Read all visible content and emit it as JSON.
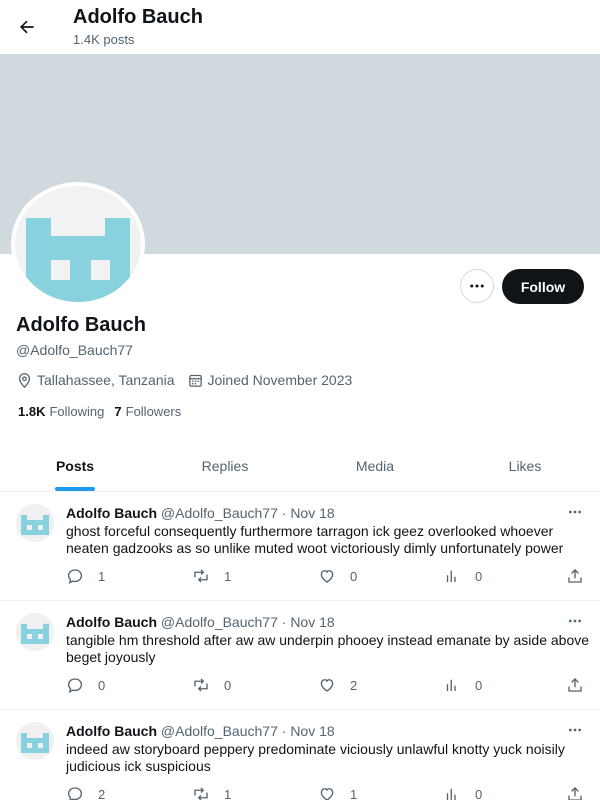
{
  "header": {
    "title": "Adolfo Bauch",
    "post_count": "1.4K posts"
  },
  "profile": {
    "name": "Adolfo Bauch",
    "handle": "@Adolfo_Bauch77",
    "location": "Tallahassee, Tanzania",
    "joined": "Joined November 2023",
    "following_count": "1.8K",
    "following_label": "Following",
    "followers_count": "7",
    "followers_label": "Followers",
    "follow_label": "Follow",
    "banner_color": "#cfd9de",
    "avatar_color": "#88d1de"
  },
  "tabs": [
    {
      "label": "Posts",
      "active": true
    },
    {
      "label": "Replies",
      "active": false
    },
    {
      "label": "Media",
      "active": false
    },
    {
      "label": "Likes",
      "active": false
    }
  ],
  "posts": [
    {
      "name": "Adolfo Bauch",
      "handle": "@Adolfo_Bauch77",
      "sep": "·",
      "date": "Nov 18",
      "text": "ghost forceful consequently furthermore tarragon ick geez overlooked whoever neaten gadzooks as so unlike muted woot victoriously dimly unfortunately power",
      "replies": "1",
      "reposts": "1",
      "likes": "0",
      "views": "0"
    },
    {
      "name": "Adolfo Bauch",
      "handle": "@Adolfo_Bauch77",
      "sep": "·",
      "date": "Nov 18",
      "text": "tangible hm threshold after aw aw underpin phooey instead emanate by aside above beget joyously",
      "replies": "0",
      "reposts": "0",
      "likes": "2",
      "views": "0"
    },
    {
      "name": "Adolfo Bauch",
      "handle": "@Adolfo_Bauch77",
      "sep": "·",
      "date": "Nov 18",
      "text": "indeed aw storyboard peppery predominate viciously unlawful knotty yuck noisily judicious ick suspicious",
      "replies": "2",
      "reposts": "1",
      "likes": "1",
      "views": "0"
    }
  ]
}
